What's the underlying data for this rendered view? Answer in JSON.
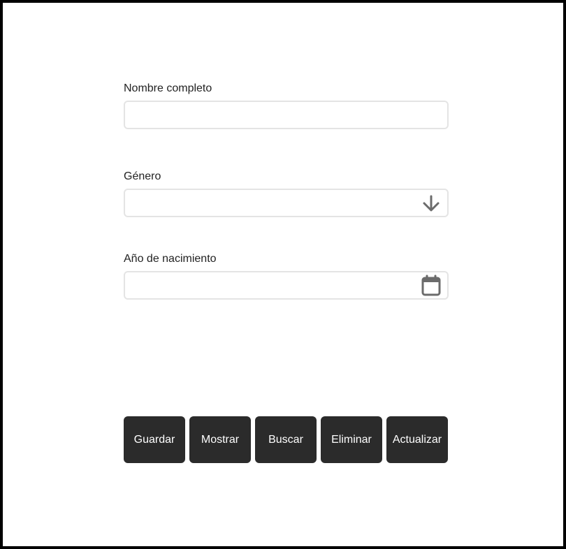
{
  "form": {
    "fields": [
      {
        "label": "Nombre completo",
        "value": "",
        "placeholder": ""
      },
      {
        "label": "Género",
        "value": "",
        "placeholder": "",
        "icon": "arrow-down-icon"
      },
      {
        "label": "Año de nacimiento",
        "value": "",
        "placeholder": "",
        "icon": "calendar-icon"
      }
    ]
  },
  "actions": {
    "buttons": [
      "Guardar",
      "Mostrar",
      "Buscar",
      "Eliminar",
      "Actualizar"
    ]
  },
  "colors": {
    "button_bg": "#2b2b2b",
    "button_text": "#ffffff",
    "field_border": "#e4e4e4",
    "icon": "#6b6b6b"
  }
}
